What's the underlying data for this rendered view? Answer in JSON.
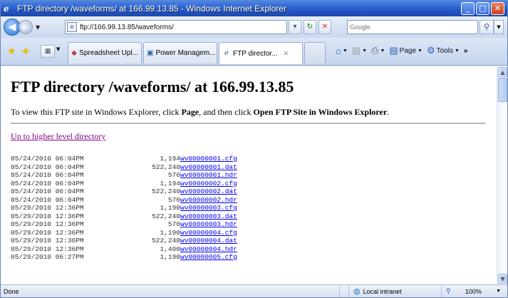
{
  "window": {
    "title": "FTP directory /waveforms/ at 166.99.13.85 - Windows Internet Explorer",
    "buttons": {
      "minimize": "_",
      "maximize": "□",
      "close": "✕"
    }
  },
  "address": {
    "url": "ftp://166.99.13.85/waveforms/",
    "search_placeholder": "Google"
  },
  "tabs": [
    {
      "label": "Spreadsheet Upl...",
      "active": false
    },
    {
      "label": "Power Managem...",
      "active": false
    },
    {
      "label": "FTP director...",
      "active": true
    }
  ],
  "commands": {
    "page": "Page",
    "tools": "Tools",
    "more": "»"
  },
  "content": {
    "title": "FTP directory /waveforms/ at 166.99.13.85",
    "instr_prefix": "To view this FTP site in Windows Explorer, click ",
    "instr_page": "Page",
    "instr_middle": ", and then click ",
    "instr_open": "Open FTP Site in Windows Explorer",
    "instr_end": ".",
    "up_link": "Up to higher level directory",
    "files": [
      {
        "date": "05/24/2010 06:04PM",
        "size": "1,194",
        "name": "wv00000001.cfg"
      },
      {
        "date": "05/24/2010 06:04PM",
        "size": "522,240",
        "name": "wv00000001.dat"
      },
      {
        "date": "05/24/2010 06:04PM",
        "size": "576",
        "name": "wv00000001.hdr"
      },
      {
        "date": "05/24/2010 06:04PM",
        "size": "1,194",
        "name": "wv00000002.cfg"
      },
      {
        "date": "05/24/2010 06:04PM",
        "size": "522,240",
        "name": "wv00000002.dat"
      },
      {
        "date": "05/24/2010 06:04PM",
        "size": "576",
        "name": "wv00000002.hdr"
      },
      {
        "date": "05/29/2010 12:36PM",
        "size": "1,190",
        "name": "wv00000003.cfg"
      },
      {
        "date": "05/29/2010 12:36PM",
        "size": "522,240",
        "name": "wv00000003.dat"
      },
      {
        "date": "05/29/2010 12:36PM",
        "size": "576",
        "name": "wv00000003.hdr"
      },
      {
        "date": "05/29/2010 12:36PM",
        "size": "1,190",
        "name": "wv00000004.cfg"
      },
      {
        "date": "05/29/2010 12:36PM",
        "size": "522,240",
        "name": "wv00000004.dat"
      },
      {
        "date": "05/29/2010 12:36PM",
        "size": "1,400",
        "name": "wv00000004.hdr"
      },
      {
        "date": "05/29/2010 06:27PM",
        "size": "1,190",
        "name": "wv00000005.cfg"
      }
    ]
  },
  "status": {
    "text": "Done",
    "zone": "Local intranet",
    "zoom": "100%"
  },
  "colors": {
    "titlebar": "#2456c8",
    "link": "#0000ee",
    "visited_link": "#800080"
  }
}
